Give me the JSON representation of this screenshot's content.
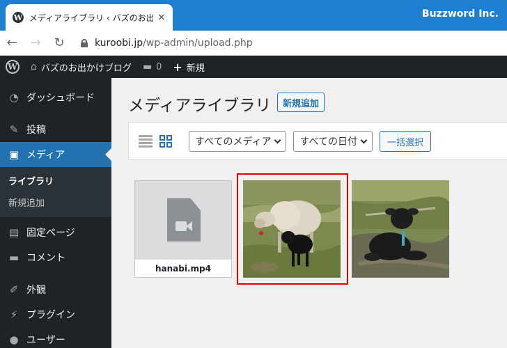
{
  "browser": {
    "tab_title": "メディアライブラリ ‹ バズのお出かけブロ",
    "tab_close": "×",
    "brand": "Buzzword Inc.",
    "url_host": "kuroobi.jp",
    "url_path": "/wp-admin/upload.php",
    "back_glyph": "←",
    "forward_glyph": "→",
    "reload_glyph": "↻"
  },
  "adminbar": {
    "site_name": "バズのお出かけブログ",
    "comment_count": "0",
    "new_label": "新規"
  },
  "sidebar": {
    "items": [
      {
        "label": "ダッシュボード",
        "icon": "dashboard-icon",
        "glyph": "◔"
      },
      {
        "label": "投稿",
        "icon": "pin-icon",
        "glyph": "✎"
      },
      {
        "label": "メディア",
        "icon": "media-icon",
        "glyph": "▣"
      },
      {
        "label": "固定ページ",
        "icon": "page-icon",
        "glyph": "▤"
      },
      {
        "label": "コメント",
        "icon": "comment-icon",
        "glyph": "▬"
      },
      {
        "label": "外観",
        "icon": "appearance-icon",
        "glyph": "✐"
      },
      {
        "label": "プラグイン",
        "icon": "plugin-icon",
        "glyph": "⚡"
      },
      {
        "label": "ユーザー",
        "icon": "user-icon",
        "glyph": "●"
      }
    ],
    "submenu": [
      "ライブラリ",
      "新規追加"
    ]
  },
  "main": {
    "title": "メディアライブラリ",
    "add_new": "新規追加",
    "filter_media": "すべてのメディア",
    "filter_date": "すべての日付",
    "bulk_select": "一括選択",
    "attachments": [
      {
        "type": "video",
        "filename": "hanabi.mp4"
      },
      {
        "type": "image",
        "subject": "sheep-with-black-lamb"
      },
      {
        "type": "image",
        "subject": "black-lamb-lying"
      }
    ]
  },
  "colors": {
    "wp_dark": "#1d2327",
    "wp_blue": "#2271b1",
    "browser_blue": "#1e7fd0",
    "highlight_red": "#e00000"
  }
}
